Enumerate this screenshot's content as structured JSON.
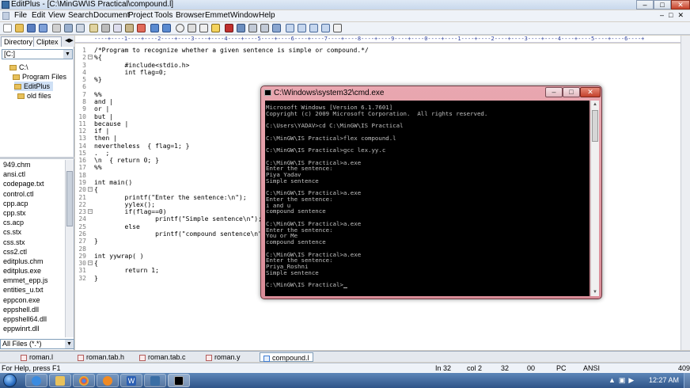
{
  "editplus": {
    "title": "EditPlus - [C:\\MinGW\\IS Practical\\compound.l]",
    "menu": [
      "File",
      "Edit",
      "View",
      "Search",
      "Document",
      "Project",
      "Tools",
      "Browser",
      "Emmet",
      "Window",
      "Help"
    ],
    "side_tabs": [
      "Directory",
      "Cliptex"
    ],
    "drive": "[C:]",
    "folders": [
      "C:\\",
      "Program Files",
      "EditPlus",
      "old files"
    ],
    "files": [
      "949.chm",
      "ansi.ctl",
      "codepage.txt",
      "control.ctl",
      "cpp.acp",
      "cpp.stx",
      "cs.acp",
      "cs.stx",
      "css.stx",
      "css2.ctl",
      "editplus.chm",
      "editplus.exe",
      "emmet_epp.js",
      "entities_u.txt",
      "eppcon.exe",
      "eppshell.dll",
      "eppshell64.dll",
      "eppwinrt.dll"
    ],
    "filter": "All Files (*.*)",
    "ruler": "----+----1----+----2----+----3----+----4----+----5----+----6----+----7----+----8----+----9----+----0----+----1----+----2----+----3----+----4----+----5----+----6----+",
    "code": [
      {
        "n": "1",
        "t": "/*Program to recognize whether a given sentence is simple or compound.*/"
      },
      {
        "n": "2",
        "t": "%{",
        "fold": true
      },
      {
        "n": "3",
        "t": "        #include<stdio.h>"
      },
      {
        "n": "4",
        "t": "        int flag=0;"
      },
      {
        "n": "5",
        "t": "%}"
      },
      {
        "n": "6",
        "t": ""
      },
      {
        "n": "7",
        "t": "%%"
      },
      {
        "n": "8",
        "t": "and |"
      },
      {
        "n": "9",
        "t": "or |"
      },
      {
        "n": "10",
        "t": "but |"
      },
      {
        "n": "11",
        "t": "because |"
      },
      {
        "n": "12",
        "t": "if |"
      },
      {
        "n": "13",
        "t": "then |"
      },
      {
        "n": "14",
        "t": "nevertheless  { flag=1; }"
      },
      {
        "n": "15",
        "t": ".  ;"
      },
      {
        "n": "16",
        "t": "\\n  { return 0; }"
      },
      {
        "n": "17",
        "t": "%%"
      },
      {
        "n": "18",
        "t": ""
      },
      {
        "n": "19",
        "t": "int main()"
      },
      {
        "n": "20",
        "t": "{",
        "fold": true
      },
      {
        "n": "21",
        "t": "        printf(\"Enter the sentence:\\n\");"
      },
      {
        "n": "22",
        "t": "        yylex();"
      },
      {
        "n": "23",
        "t": "        if(flag==0)",
        "fold": true
      },
      {
        "n": "24",
        "t": "                printf(\"Simple sentence\\n\");"
      },
      {
        "n": "25",
        "t": "        else"
      },
      {
        "n": "26",
        "t": "                printf(\"compound sentence\\n\");"
      },
      {
        "n": "27",
        "t": "}"
      },
      {
        "n": "28",
        "t": ""
      },
      {
        "n": "29",
        "t": "int yywrap( )"
      },
      {
        "n": "30",
        "t": "{",
        "fold": true
      },
      {
        "n": "31",
        "t": "        return 1;"
      },
      {
        "n": "32",
        "t": "}"
      }
    ],
    "doc_tabs": [
      "roman.l",
      "roman.tab.h",
      "roman.tab.c",
      "roman.y",
      "compound.l"
    ],
    "active_tab": "compound.l",
    "status": {
      "help": "For Help, press F1",
      "line": "In 32",
      "col": "col 2",
      "num": "32",
      "sel": "00",
      "mode": "PC",
      "enc": "ANSI",
      "size": "409"
    }
  },
  "cmd": {
    "title": "C:\\Windows\\system32\\cmd.exe",
    "lines": [
      "Microsoft Windows [Version 6.1.7601]",
      "Copyright (c) 2009 Microsoft Corporation.  All rights reserved.",
      "",
      "C:\\Users\\YADAV>cd C:\\MinGW\\IS Practical",
      "",
      "C:\\MinGW\\IS Practical>flex compound.l",
      "",
      "C:\\MinGW\\IS Practical>gcc lex.yy.c",
      "",
      "C:\\MinGW\\IS Practical>a.exe",
      "Enter the sentence:",
      "Piya Yadav",
      "Simple sentence",
      "",
      "C:\\MinGW\\IS Practical>a.exe",
      "Enter the sentence:",
      "i and u",
      "compound sentence",
      "",
      "C:\\MinGW\\IS Practical>a.exe",
      "Enter the sentence:",
      "You or Me",
      "compound sentence",
      "",
      "C:\\MinGW\\IS Practical>a.exe",
      "Enter the sentence:",
      "Priya_Roshni",
      "Simple sentence",
      "",
      "C:\\MinGW\\IS Practical>"
    ]
  },
  "taskbar": {
    "clock": "12:27 AM",
    "apps": [
      "internet-explorer",
      "explorer",
      "chrome",
      "media-player",
      "word",
      "editplus",
      "cmd"
    ]
  },
  "colors": {
    "cmd_frame": "#d98c97",
    "console_bg": "#000000",
    "console_fg": "#c0c0c0",
    "taskbar": "#2f5488"
  }
}
